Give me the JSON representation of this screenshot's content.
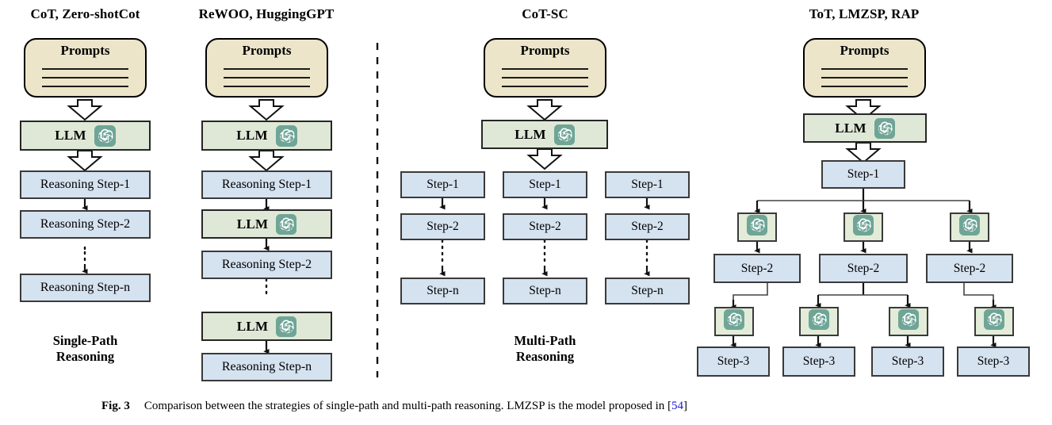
{
  "figure": {
    "caption_fig": "Fig. 3",
    "caption_text": "Comparison between the strategies of single-path and multi-path reasoning. LMZSP is the model proposed in [",
    "caption_ref": "54",
    "caption_tail": "]",
    "ref_color": "#1a18d6"
  },
  "colors": {
    "prompts_fill": "#ece5c9",
    "llm_fill": "#dfe8d6",
    "step_fill": "#d5e2f0",
    "gpt_fill": "#e2ecd9",
    "openai_logo": "#6fa596",
    "stroke": "#262626"
  },
  "common": {
    "prompts_label": "Prompts",
    "llm_label": "LLM",
    "openai_icon": "openai-logo-icon"
  },
  "groups": {
    "single_path_label": "Single-Path\nReasoning",
    "multi_path_label": "Multi-Path\nReasoning"
  },
  "columns": [
    {
      "id": "cot",
      "title": "CoT, Zero-shotCot",
      "nodes": [
        {
          "type": "prompts",
          "label": "Prompts"
        },
        {
          "type": "llm",
          "label": "LLM"
        },
        {
          "type": "step",
          "label": "Reasoning Step-1"
        },
        {
          "type": "step",
          "label": "Reasoning Step-2"
        },
        {
          "type": "step",
          "label": "Reasoning Step-n"
        }
      ]
    },
    {
      "id": "rewoo",
      "title": "ReWOO, HuggingGPT",
      "nodes": [
        {
          "type": "prompts",
          "label": "Prompts"
        },
        {
          "type": "llm",
          "label": "LLM"
        },
        {
          "type": "step",
          "label": "Reasoning Step-1"
        },
        {
          "type": "llm",
          "label": "LLM"
        },
        {
          "type": "step",
          "label": "Reasoning Step-2"
        },
        {
          "type": "llm",
          "label": "LLM"
        },
        {
          "type": "step",
          "label": "Reasoning Step-n"
        }
      ]
    },
    {
      "id": "cotsc",
      "title": "CoT-SC",
      "nodes": [
        {
          "type": "prompts",
          "label": "Prompts"
        },
        {
          "type": "llm",
          "label": "LLM"
        }
      ],
      "paths": [
        {
          "steps": [
            "Step-1",
            "Step-2",
            "Step-n"
          ]
        },
        {
          "steps": [
            "Step-1",
            "Step-2",
            "Step-n"
          ]
        },
        {
          "steps": [
            "Step-1",
            "Step-2",
            "Step-n"
          ]
        }
      ]
    },
    {
      "id": "tot",
      "title": "ToT, LMZSP, RAP",
      "nodes": [
        {
          "type": "prompts",
          "label": "Prompts"
        },
        {
          "type": "llm",
          "label": "LLM"
        }
      ],
      "tree": {
        "root": "Step-1",
        "level2": [
          "Step-2",
          "Step-2",
          "Step-2"
        ],
        "level3": [
          "Step-3",
          "Step-3",
          "Step-3",
          "Step-3"
        ]
      }
    }
  ],
  "labels": {
    "cot_title": "CoT, Zero-shotCot",
    "rewoo_title": "ReWOO, HuggingGPT",
    "cotsc_title": "CoT-SC",
    "tot_title": "ToT, LMZSP, RAP",
    "single_path_l1": "Single-Path",
    "single_path_l2": "Reasoning",
    "multi_path_l1": "Multi-Path",
    "multi_path_l2": "Reasoning",
    "reasoning_step_1": "Reasoning Step-1",
    "reasoning_step_2": "Reasoning Step-2",
    "reasoning_step_n": "Reasoning Step-n",
    "step_1": "Step-1",
    "step_2": "Step-2",
    "step_3": "Step-3",
    "step_n": "Step-n",
    "prompts": "Prompts",
    "llm": "LLM"
  }
}
